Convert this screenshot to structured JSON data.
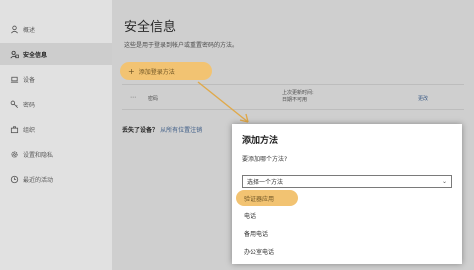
{
  "sidebar": {
    "items": [
      {
        "label": "概述",
        "icon": "person-icon",
        "active": false
      },
      {
        "label": "安全信息",
        "icon": "security-info-icon",
        "active": true
      },
      {
        "label": "设备",
        "icon": "laptop-icon",
        "active": false
      },
      {
        "label": "密码",
        "icon": "key-icon",
        "active": false
      },
      {
        "label": "组织",
        "icon": "briefcase-icon",
        "active": false
      },
      {
        "label": "设置和隐私",
        "icon": "gear-icon",
        "active": false
      },
      {
        "label": "最近的活动",
        "icon": "clock-icon",
        "active": false
      }
    ]
  },
  "main": {
    "title": "安全信息",
    "subtitle": "这些是用于登录到帐户或重置密码的方法。",
    "add_method_label": "添加登录方法",
    "method_card": {
      "icon_glyph": "⋯",
      "label": "密码",
      "updated_line1": "上次更新时间:",
      "updated_line2": "日期不可用",
      "change_link": "更改"
    },
    "lost_device_text": "丢失了设备？",
    "lost_device_link": "从所有位置注销"
  },
  "dialog": {
    "title": "添加方法",
    "question": "要添加哪个方法?",
    "select_placeholder": "选择一个方法",
    "options": [
      "验证器应用",
      "电话",
      "备用电话",
      "办公室电话"
    ]
  },
  "colors": {
    "highlight": "#f2c372",
    "link": "#3a5a85"
  }
}
